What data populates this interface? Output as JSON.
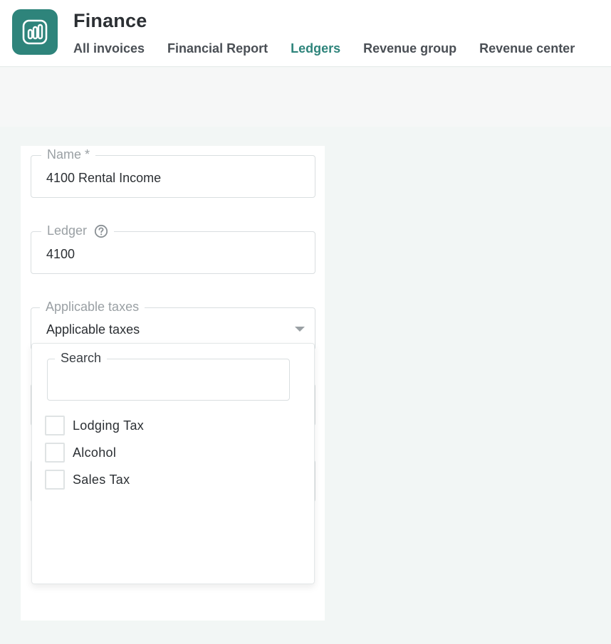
{
  "app": {
    "title": "Finance",
    "icon": "bar-chart-icon",
    "accent_color": "#2e847b"
  },
  "nav": {
    "items": [
      {
        "label": "All invoices",
        "active": false
      },
      {
        "label": "Financial Report",
        "active": false
      },
      {
        "label": "Ledgers",
        "active": true
      },
      {
        "label": "Revenue group",
        "active": false
      },
      {
        "label": "Revenue center",
        "active": false
      }
    ]
  },
  "form": {
    "name": {
      "label": "Name *",
      "value": "4100 Rental Income"
    },
    "ledger": {
      "label": "Ledger",
      "value": "4100",
      "help_icon": "question-circle-icon"
    },
    "taxes": {
      "label": "Applicable taxes",
      "value": "Applicable taxes",
      "caret_icon": "caret-down-icon"
    }
  },
  "dropdown": {
    "search": {
      "label": "Search",
      "value": ""
    },
    "options": [
      {
        "label": "Lodging Tax",
        "checked": false
      },
      {
        "label": "Alcohol",
        "checked": false
      },
      {
        "label": "Sales Tax",
        "checked": false
      }
    ]
  }
}
